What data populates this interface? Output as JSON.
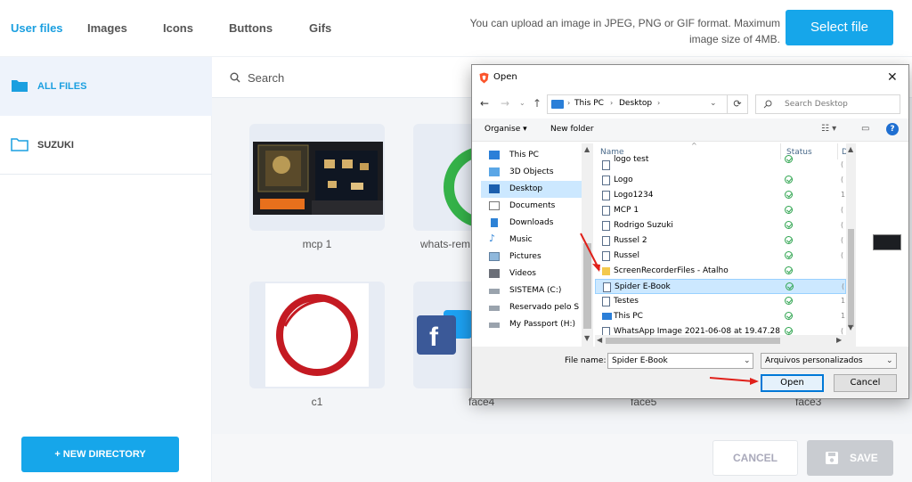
{
  "tabs": [
    "User files",
    "Images",
    "Icons",
    "Buttons",
    "Gifs"
  ],
  "upload_hint": "You can upload an image in JPEG, PNG or GIF format. Maximum image size of 4MB.",
  "select_file_label": "Select file",
  "sidebar": {
    "items": [
      {
        "label": "ALL FILES",
        "active": true
      },
      {
        "label": "SUZUKI",
        "active": false
      }
    ],
    "new_directory_label": "+ NEW DIRECTORY"
  },
  "search": {
    "placeholder": "Search"
  },
  "files": [
    {
      "name": "mcp 1"
    },
    {
      "name": "whats-rem"
    },
    {
      "name": "c1"
    },
    {
      "name": "face4"
    },
    {
      "name": "face5"
    },
    {
      "name": "face3"
    }
  ],
  "footer": {
    "cancel_label": "CANCEL",
    "save_label": "SAVE"
  },
  "dialog": {
    "title": "Open",
    "close_glyph": "✕",
    "address": [
      "This PC",
      "Desktop"
    ],
    "search_placeholder": "Search Desktop",
    "organise_label": "Organise ▾",
    "new_folder_label": "New folder",
    "help_glyph": "?",
    "nav_items": [
      {
        "label": "This PC",
        "icon": "pc-icon",
        "selected": false
      },
      {
        "label": "3D Objects",
        "icon": "cube-icon",
        "selected": false
      },
      {
        "label": "Desktop",
        "icon": "desktop-icon",
        "selected": true
      },
      {
        "label": "Documents",
        "icon": "document-icon",
        "selected": false
      },
      {
        "label": "Downloads",
        "icon": "download-icon",
        "selected": false
      },
      {
        "label": "Music",
        "icon": "music-icon",
        "selected": false
      },
      {
        "label": "Pictures",
        "icon": "pictures-icon",
        "selected": false
      },
      {
        "label": "Videos",
        "icon": "video-icon",
        "selected": false
      },
      {
        "label": "SISTEMA (C:)",
        "icon": "drive-icon",
        "selected": false
      },
      {
        "label": "Reservado pelo S",
        "icon": "drive-icon",
        "selected": false
      },
      {
        "label": "My Passport (H:)",
        "icon": "drive-icon",
        "selected": false
      }
    ],
    "columns": {
      "name": "Name",
      "status": "Status",
      "extra": "D"
    },
    "file_rows": [
      {
        "name": "logo test",
        "type": "file",
        "selected": false,
        "extra": "("
      },
      {
        "name": "Logo",
        "type": "file",
        "selected": false,
        "extra": "("
      },
      {
        "name": "Logo1234",
        "type": "file",
        "selected": false,
        "extra": "1"
      },
      {
        "name": "MCP 1",
        "type": "file",
        "selected": false,
        "extra": "("
      },
      {
        "name": "Rodrigo Suzuki",
        "type": "file",
        "selected": false,
        "extra": "("
      },
      {
        "name": "Russel 2",
        "type": "file",
        "selected": false,
        "extra": "("
      },
      {
        "name": "Russel",
        "type": "file",
        "selected": false,
        "extra": "("
      },
      {
        "name": "ScreenRecorderFiles - Atalho",
        "type": "folder",
        "selected": false,
        "extra": ""
      },
      {
        "name": "Spider E-Book",
        "type": "file",
        "selected": true,
        "extra": "("
      },
      {
        "name": "Testes",
        "type": "file",
        "selected": false,
        "extra": "1"
      },
      {
        "name": "This PC",
        "type": "pc",
        "selected": false,
        "extra": "1"
      },
      {
        "name": "WhatsApp Image 2021-06-08 at 19.47.28",
        "type": "file",
        "selected": false,
        "extra": "("
      }
    ],
    "file_name_label": "File name:",
    "file_name_value": "Spider E-Book",
    "file_type_value": "Arquivos personalizados",
    "open_label": "Open",
    "cancel_label": "Cancel"
  },
  "colors": {
    "accent": "#16a6ea",
    "selection": "#cce8ff",
    "annotation": "#e0201a"
  }
}
